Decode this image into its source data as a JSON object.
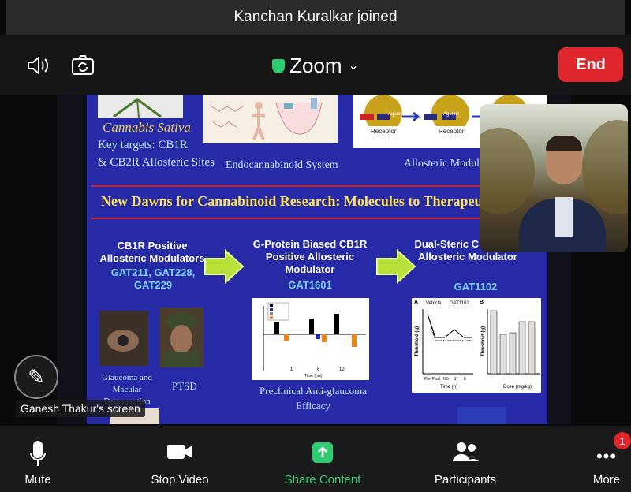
{
  "notification": {
    "text": "Kanchan Kuralkar joined"
  },
  "topbar": {
    "speaker_icon": "speaker-icon",
    "camera_switch_icon": "camera-switch-icon",
    "title": "Zoom",
    "end_label": "End"
  },
  "slide": {
    "cannabis_title": "Cannabis Sativa",
    "cannabis_targets_1": "Key targets: CB1R",
    "cannabis_targets_2": "& CB2R Allosteric Sites",
    "endocannabinoid_label": "Endocannabinoid System",
    "allosteric_label": "Allosteric Modulatio",
    "receptor_label": "Receptor",
    "receptor_label_2": "Receptor",
    "agonist_label": "Agonist",
    "agonist_label_2": "Agonist",
    "headline": "New Dawns for Cannabinoid Research: Molecules to Therapeutic D",
    "col1_title": "CB1R Positive Allosteric Modulators",
    "col1_compounds": "GAT211, GAT228, GAT229",
    "col2_title": "G-Protein Biased CB1R Positive Allosteric Modulator",
    "col2_compound": "GAT1601",
    "col3_title": "Dual-Steric C Positive Allosteric Modulator",
    "col3_compound": "GAT1102",
    "glaucoma_caption": "Glaucoma and Macular Degeneration",
    "ptsd_caption": "PTSD",
    "preclinical_caption": "Preclinical Anti-glaucoma Efficacy",
    "legend_vehicle": "Vehicle",
    "legend_gat1102": "GAT1102",
    "ylabel_threshold": "Threshold (g)",
    "xlabel_time": "Time (h)",
    "xlabel_dose": "Dose (mg/kg)",
    "panel_a": "A",
    "panel_b": "B",
    "bar_ticks": [
      "1",
      "6",
      "12"
    ],
    "bar_xlabel": "Time (hrs)",
    "line_ticks": [
      "Pre",
      "Post",
      "0.5",
      "2",
      "6"
    ]
  },
  "pen_icon": "pen-icon",
  "screen_label": "Ganesh Thakur's screen",
  "toolbar": {
    "mute": "Mute",
    "stop_video": "Stop Video",
    "share_content": "Share Content",
    "participants": "Participants",
    "more": "More",
    "more_badge": "1"
  },
  "colors": {
    "end_red": "#e0262d",
    "share_green": "#2ecc71",
    "slide_blue": "#262aa6"
  }
}
